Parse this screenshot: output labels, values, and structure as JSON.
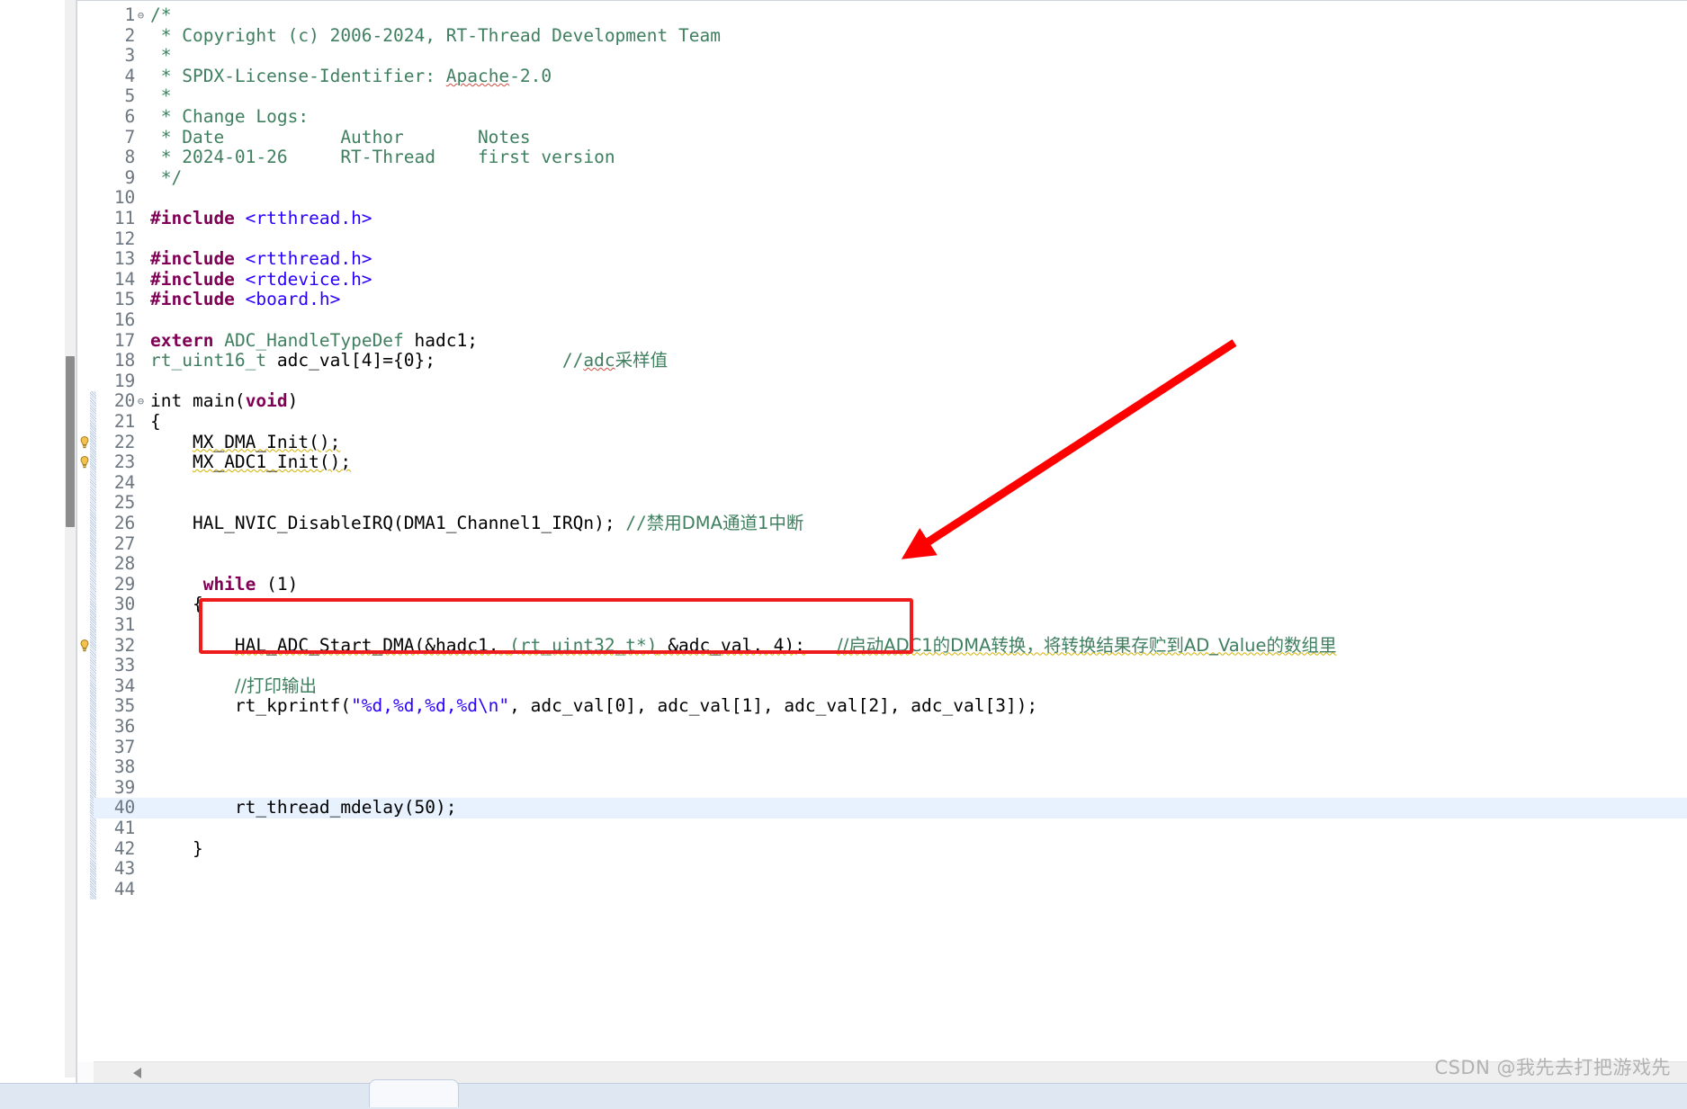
{
  "editor": {
    "language": "c",
    "current_line": 40,
    "highlight_color": "#ee1c1c",
    "arrow_color": "#ff0000",
    "lines": [
      {
        "n": "1",
        "fold": "⊖",
        "segments": [
          {
            "t": "comment",
            "s": "/*"
          }
        ]
      },
      {
        "n": "2",
        "fold": "",
        "segments": [
          {
            "t": "comment",
            "s": " * Copyright (c) 2006-2024, RT-Thread Development Team"
          }
        ]
      },
      {
        "n": "3",
        "fold": "",
        "segments": [
          {
            "t": "comment",
            "s": " *"
          }
        ]
      },
      {
        "n": "4",
        "fold": "",
        "segments": [
          {
            "t": "comment",
            "s": " * SPDX-License-Identifier: "
          },
          {
            "t": "comment-spell",
            "s": "Apache"
          },
          {
            "t": "comment",
            "s": "-2.0"
          }
        ]
      },
      {
        "n": "5",
        "fold": "",
        "segments": [
          {
            "t": "comment",
            "s": " *"
          }
        ]
      },
      {
        "n": "6",
        "fold": "",
        "segments": [
          {
            "t": "comment",
            "s": " * Change Logs:"
          }
        ]
      },
      {
        "n": "7",
        "fold": "",
        "segments": [
          {
            "t": "comment",
            "s": " * Date           Author       Notes"
          }
        ]
      },
      {
        "n": "8",
        "fold": "",
        "segments": [
          {
            "t": "comment",
            "s": " * 2024-01-26     RT-Thread    first version"
          }
        ]
      },
      {
        "n": "9",
        "fold": "",
        "segments": [
          {
            "t": "comment",
            "s": " */"
          }
        ]
      },
      {
        "n": "10",
        "fold": "",
        "segments": []
      },
      {
        "n": "11",
        "fold": "",
        "segments": [
          {
            "t": "prep",
            "s": "#include"
          },
          {
            "t": "plain",
            "s": " "
          },
          {
            "t": "header",
            "s": "<rtthread.h>"
          }
        ]
      },
      {
        "n": "12",
        "fold": "",
        "segments": []
      },
      {
        "n": "13",
        "fold": "",
        "segments": [
          {
            "t": "prep",
            "s": "#include"
          },
          {
            "t": "plain",
            "s": " "
          },
          {
            "t": "header",
            "s": "<rtthread.h>"
          }
        ]
      },
      {
        "n": "14",
        "fold": "",
        "segments": [
          {
            "t": "prep",
            "s": "#include"
          },
          {
            "t": "plain",
            "s": " "
          },
          {
            "t": "header",
            "s": "<rtdevice.h>"
          }
        ]
      },
      {
        "n": "15",
        "fold": "",
        "segments": [
          {
            "t": "prep",
            "s": "#include"
          },
          {
            "t": "plain",
            "s": " "
          },
          {
            "t": "header",
            "s": "<board.h>"
          }
        ]
      },
      {
        "n": "16",
        "fold": "",
        "segments": []
      },
      {
        "n": "17",
        "fold": "",
        "segments": [
          {
            "t": "keyword",
            "s": "extern"
          },
          {
            "t": "plain",
            "s": " "
          },
          {
            "t": "type",
            "s": "ADC_HandleTypeDef"
          },
          {
            "t": "plain",
            "s": " hadc1;"
          }
        ]
      },
      {
        "n": "18",
        "fold": "",
        "segments": [
          {
            "t": "type",
            "s": "rt_uint16_t"
          },
          {
            "t": "plain",
            "s": " adc_val[4]={0};"
          },
          {
            "t": "plain",
            "s": "            "
          },
          {
            "t": "comment",
            "s": "//"
          },
          {
            "t": "comment-spell",
            "s": "adc"
          },
          {
            "t": "comment-zh",
            "s": "采样值"
          }
        ]
      },
      {
        "n": "19",
        "fold": "",
        "segments": []
      },
      {
        "n": "20",
        "fold": "⊖",
        "segments": [
          {
            "t": "plain",
            "s": "int"
          },
          {
            "t": "plain",
            "s": " main("
          },
          {
            "t": "keyword",
            "s": "void"
          },
          {
            "t": "plain",
            "s": ")"
          }
        ]
      },
      {
        "n": "21",
        "fold": "",
        "segments": [
          {
            "t": "plain",
            "s": "{"
          }
        ]
      },
      {
        "n": "22",
        "fold": "",
        "warn": true,
        "segments": [
          {
            "t": "plain",
            "s": "    "
          },
          {
            "t": "warn",
            "s": "MX_DMA_Init();"
          }
        ]
      },
      {
        "n": "23",
        "fold": "",
        "warn": true,
        "segments": [
          {
            "t": "plain",
            "s": "    "
          },
          {
            "t": "warn",
            "s": "MX_ADC1_Init();"
          }
        ]
      },
      {
        "n": "24",
        "fold": "",
        "segments": []
      },
      {
        "n": "25",
        "fold": "",
        "segments": []
      },
      {
        "n": "26",
        "fold": "",
        "segments": [
          {
            "t": "plain",
            "s": "    HAL_NVIC_DisableIRQ(DMA1_Channel1_IRQn); "
          },
          {
            "t": "comment",
            "s": "//"
          },
          {
            "t": "comment-zh",
            "s": "禁用DMA通道1中断"
          }
        ]
      },
      {
        "n": "27",
        "fold": "",
        "segments": []
      },
      {
        "n": "28",
        "fold": "",
        "segments": []
      },
      {
        "n": "29",
        "fold": "",
        "segments": [
          {
            "t": "plain",
            "s": "     "
          },
          {
            "t": "keyword",
            "s": "while"
          },
          {
            "t": "plain",
            "s": " (1)"
          }
        ]
      },
      {
        "n": "30",
        "fold": "",
        "segments": [
          {
            "t": "plain",
            "s": "    {"
          }
        ]
      },
      {
        "n": "31",
        "fold": "",
        "segments": []
      },
      {
        "n": "32",
        "fold": "",
        "warn": true,
        "segments": [
          {
            "t": "plain",
            "s": "        "
          },
          {
            "t": "warn",
            "s": "HAL_ADC_Start_DMA(&hadc1, "
          },
          {
            "t": "warn-type",
            "s": "(rt_uint32_t*)"
          },
          {
            "t": "warn",
            "s": " &adc_val, 4);"
          },
          {
            "t": "plain",
            "s": "   "
          },
          {
            "t": "comment-warn",
            "s": "//启动ADC1的DMA转换，将转换结果存贮到AD_Value的数组里"
          }
        ]
      },
      {
        "n": "33",
        "fold": "",
        "segments": []
      },
      {
        "n": "34",
        "fold": "",
        "segments": [
          {
            "t": "plain",
            "s": "        "
          },
          {
            "t": "comment-zh",
            "s": "//打印输出"
          }
        ]
      },
      {
        "n": "35",
        "fold": "",
        "segments": [
          {
            "t": "plain",
            "s": "        rt_kprintf("
          },
          {
            "t": "string",
            "s": "\"%d,%d,%d,%d\\n\""
          },
          {
            "t": "plain",
            "s": ", adc_val[0], adc_val[1], adc_val[2], adc_val[3]);"
          }
        ]
      },
      {
        "n": "36",
        "fold": "",
        "segments": []
      },
      {
        "n": "37",
        "fold": "",
        "segments": []
      },
      {
        "n": "38",
        "fold": "",
        "segments": []
      },
      {
        "n": "39",
        "fold": "",
        "segments": []
      },
      {
        "n": "40",
        "fold": "",
        "current": true,
        "segments": [
          {
            "t": "plain",
            "s": "        rt_thread_mdelay(50);"
          }
        ]
      },
      {
        "n": "41",
        "fold": "",
        "segments": []
      },
      {
        "n": "42",
        "fold": "",
        "segments": [
          {
            "t": "plain",
            "s": "    }"
          }
        ]
      },
      {
        "n": "43",
        "fold": "",
        "segments": []
      },
      {
        "n": "44",
        "fold": "",
        "segments": []
      }
    ]
  },
  "annotations": {
    "highlight_box_label": "HAL_NVIC_DisableIRQ(DMA1_Channel1_IRQn); //禁用DMA通道1中断",
    "arrow_label": "pointer-to-highlighted-line"
  },
  "watermark": {
    "text": "CSDN @我先去打把游戏先"
  },
  "scrollbars": {
    "vertical_position": "33%",
    "horizontal_position": "0%"
  }
}
